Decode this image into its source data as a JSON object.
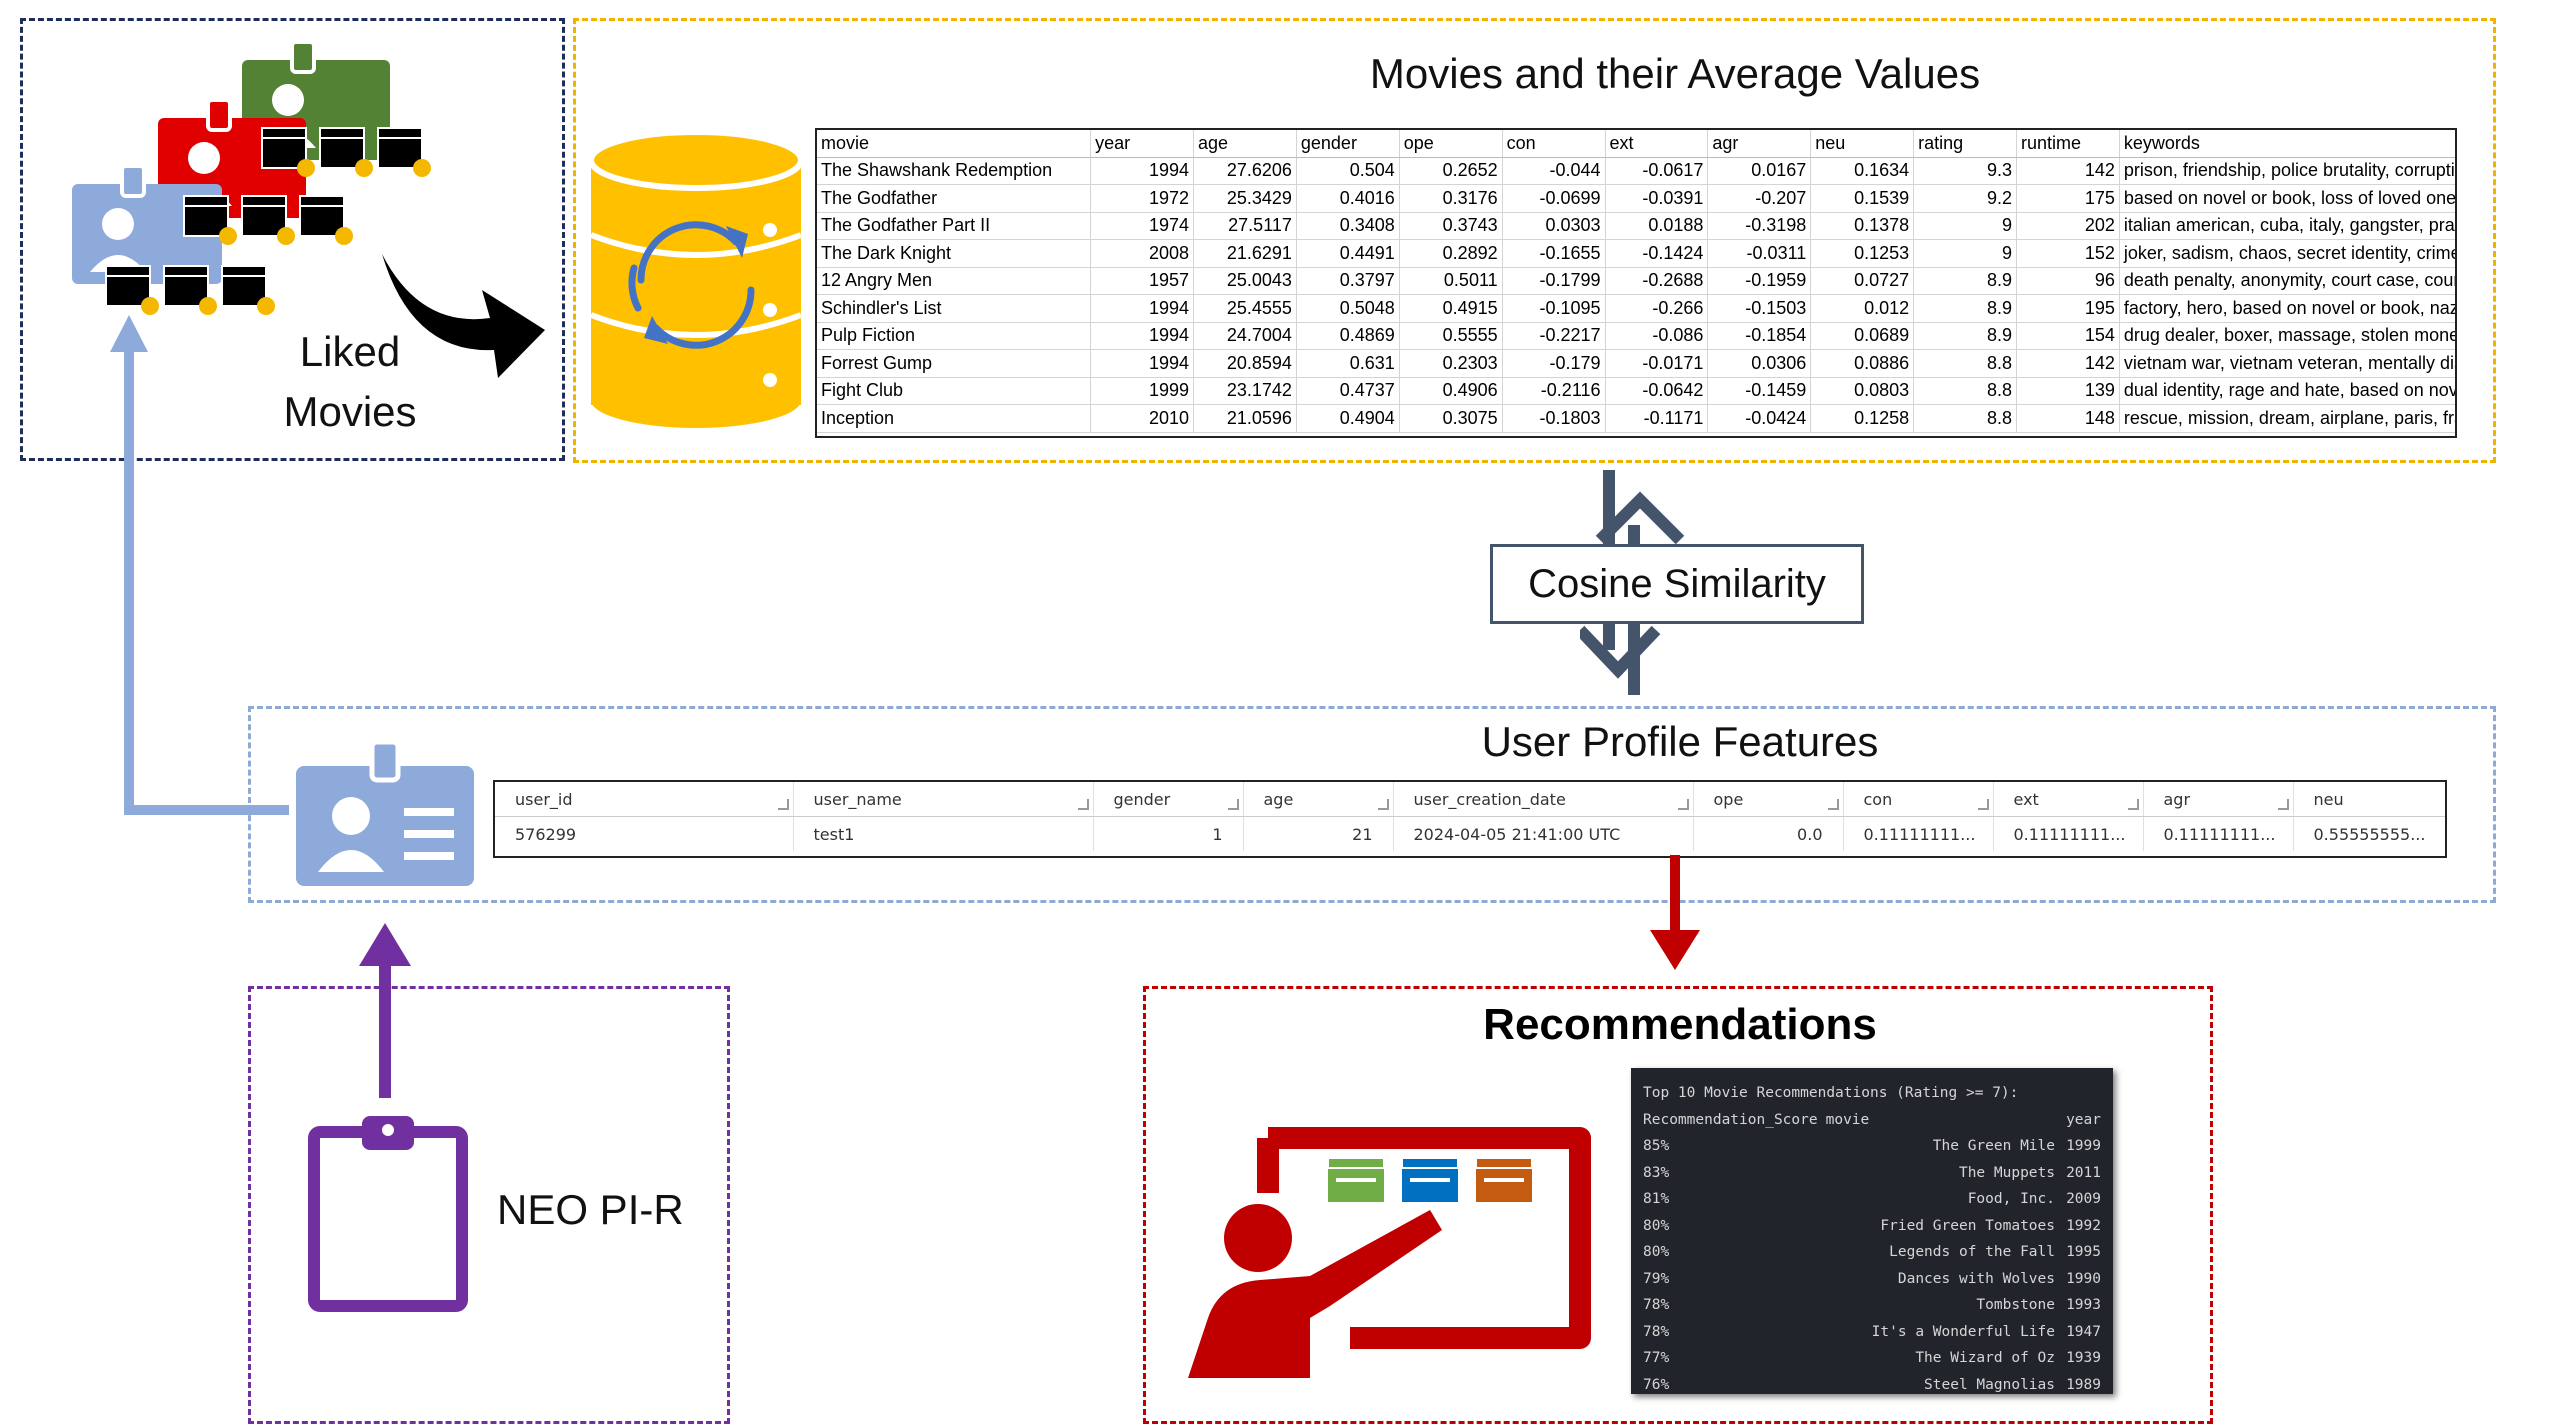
{
  "liked": {
    "line1": "Liked",
    "line2": "Movies"
  },
  "movies_section": {
    "title": "Movies and their Average Values",
    "columns": [
      "movie",
      "year",
      "age",
      "gender",
      "ope",
      "con",
      "ext",
      "agr",
      "neu",
      "rating",
      "runtime",
      "keywords"
    ],
    "rows": [
      [
        "The Shawshank Redemption",
        "1994",
        "27.6206",
        "0.504",
        "0.2652",
        "-0.044",
        "-0.0617",
        "0.0167",
        "0.1634",
        "9.3",
        "142",
        "prison, friendship, police brutality, corruption, i"
      ],
      [
        "The Godfather",
        "1972",
        "25.3429",
        "0.4016",
        "0.3176",
        "-0.0699",
        "-0.0391",
        "-0.207",
        "0.1539",
        "9.2",
        "175",
        "based on novel or book, loss of loved one, love a"
      ],
      [
        "The Godfather Part II",
        "1974",
        "27.5117",
        "0.3408",
        "0.3743",
        "0.0303",
        "0.0188",
        "-0.3198",
        "0.1378",
        "9",
        "202",
        "italian american, cuba, italy, gangster, praise, st"
      ],
      [
        "The Dark Knight",
        "2008",
        "21.6291",
        "0.4491",
        "0.2892",
        "-0.1655",
        "-0.1424",
        "-0.0311",
        "0.1253",
        "9",
        "152",
        "joker, sadism, chaos, secret identity, crime fight"
      ],
      [
        "12 Angry Men",
        "1957",
        "25.0043",
        "0.3797",
        "0.5011",
        "-0.1799",
        "-0.2688",
        "-0.1959",
        "0.0727",
        "8.9",
        "96",
        "death penalty, anonymity, court case, court, jud"
      ],
      [
        "Schindler's List",
        "1994",
        "25.4555",
        "0.5048",
        "0.4915",
        "-0.1095",
        "-0.266",
        "-0.1503",
        "0.012",
        "8.9",
        "195",
        "factory, hero, based on novel or book, nazi, conc"
      ],
      [
        "Pulp Fiction",
        "1994",
        "24.7004",
        "0.4869",
        "0.5555",
        "-0.2217",
        "-0.086",
        "-0.1854",
        "0.0689",
        "8.9",
        "154",
        "drug dealer, boxer, massage, stolen money, brie"
      ],
      [
        "Forrest Gump",
        "1994",
        "20.8594",
        "0.631",
        "0.2303",
        "-0.179",
        "-0.0171",
        "0.0306",
        "0.0886",
        "8.8",
        "142",
        "vietnam war, vietnam veteran, mentally disable"
      ],
      [
        "Fight Club",
        "1999",
        "23.1742",
        "0.4737",
        "0.4906",
        "-0.2116",
        "-0.0642",
        "-0.1459",
        "0.0803",
        "8.8",
        "139",
        "dual identity, rage and hate, based on novel or"
      ],
      [
        "Inception",
        "2010",
        "21.0596",
        "0.4904",
        "0.3075",
        "-0.1803",
        "-0.1171",
        "-0.0424",
        "0.1258",
        "8.8",
        "148",
        "rescue, mission, dream, airplane, paris, france, s"
      ]
    ]
  },
  "cosine_label": "Cosine Similarity",
  "user_profile": {
    "title": "User Profile Features",
    "columns": [
      "user_id",
      "user_name",
      "gender",
      "age",
      "user_creation_date",
      "ope",
      "con",
      "ext",
      "agr",
      "neu"
    ],
    "row": [
      "576299",
      "test1",
      "1",
      "21",
      "2024-04-05 21:41:00 UTC",
      "0.0",
      "0.11111111...",
      "0.11111111...",
      "0.11111111...",
      "0.55555555..."
    ]
  },
  "neo_label": "NEO PI-R",
  "recommendations": {
    "title": "Recommendations",
    "terminal_header": "Top 10 Movie Recommendations (Rating >= 7):",
    "col_score": "Recommendation_Score",
    "col_movie": "movie",
    "col_year": "year",
    "items": [
      {
        "score": "85%",
        "movie": "The Green Mile",
        "year": "1999"
      },
      {
        "score": "83%",
        "movie": "The Muppets",
        "year": "2011"
      },
      {
        "score": "81%",
        "movie": "Food, Inc.",
        "year": "2009"
      },
      {
        "score": "80%",
        "movie": "Fried Green Tomatoes",
        "year": "1992"
      },
      {
        "score": "80%",
        "movie": "Legends of the Fall",
        "year": "1995"
      },
      {
        "score": "79%",
        "movie": "Dances with Wolves",
        "year": "1990"
      },
      {
        "score": "78%",
        "movie": "Tombstone",
        "year": "1993"
      },
      {
        "score": "78%",
        "movie": "It's a Wonderful Life",
        "year": "1947"
      },
      {
        "score": "77%",
        "movie": "The Wizard of Oz",
        "year": "1939"
      },
      {
        "score": "76%",
        "movie": "Steel Magnolias",
        "year": "1989"
      }
    ]
  },
  "colors": {
    "navy_border": "#1f2d5a",
    "yellow_border": "#f0b400",
    "blue_border": "#8fa9d6",
    "purple_border": "#7030a0",
    "red_border": "#c00000",
    "db_yellow": "#ffc000",
    "id_blue": "#8eaadb",
    "arrow_slate": "#44546a"
  }
}
